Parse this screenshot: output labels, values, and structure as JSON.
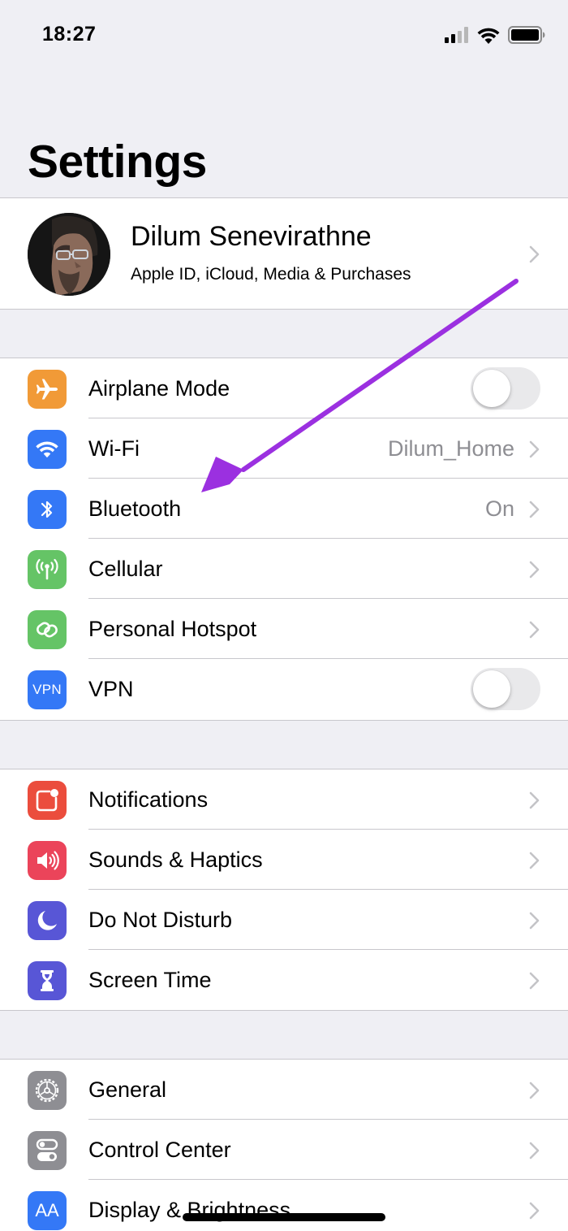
{
  "status_bar": {
    "time": "18:27",
    "signal_icon": "cellular-signal-icon",
    "wifi_icon": "wifi-icon",
    "battery_icon": "battery-icon"
  },
  "page": {
    "title": "Settings"
  },
  "profile": {
    "name": "Dilum Senevirathne",
    "subtitle": "Apple ID, iCloud, Media & Purchases",
    "avatar_icon": "avatar"
  },
  "connectivity": [
    {
      "label": "Airplane Mode",
      "value": "",
      "icon": "airplane-icon",
      "color": "#f19a37",
      "control": "toggle",
      "toggle_on": false
    },
    {
      "label": "Wi-Fi",
      "value": "Dilum_Home",
      "icon": "wifi-icon",
      "color": "#3478f6",
      "control": "chevron"
    },
    {
      "label": "Bluetooth",
      "value": "On",
      "icon": "bluetooth-icon",
      "color": "#3478f6",
      "control": "chevron"
    },
    {
      "label": "Cellular",
      "value": "",
      "icon": "cellular-antenna-icon",
      "color": "#65c466",
      "control": "chevron"
    },
    {
      "label": "Personal Hotspot",
      "value": "",
      "icon": "hotspot-link-icon",
      "color": "#65c466",
      "control": "chevron"
    },
    {
      "label": "VPN",
      "value": "",
      "icon": "vpn-icon",
      "color": "#3478f6",
      "control": "toggle",
      "toggle_on": false,
      "icon_text": "VPN"
    }
  ],
  "alerts": [
    {
      "label": "Notifications",
      "icon": "notifications-icon",
      "color": "#eb4d3d"
    },
    {
      "label": "Sounds & Haptics",
      "icon": "speaker-icon",
      "color": "#eb445a"
    },
    {
      "label": "Do Not Disturb",
      "icon": "moon-icon",
      "color": "#5856d6"
    },
    {
      "label": "Screen Time",
      "icon": "hourglass-icon",
      "color": "#5856d6"
    }
  ],
  "general": [
    {
      "label": "General",
      "icon": "gear-icon",
      "color": "#8e8e93"
    },
    {
      "label": "Control Center",
      "icon": "toggles-icon",
      "color": "#8e8e93"
    },
    {
      "label": "Display & Brightness",
      "icon": "display-brightness-icon",
      "color": "#3478f6",
      "icon_text": "AA"
    }
  ],
  "annotation": {
    "arrow_color": "#9b30e0",
    "arrow_icon": "annotation-arrow"
  },
  "colors": {
    "background": "#efeff4",
    "separator": "#c8c7cc",
    "secondary_text": "#8e8e93"
  }
}
